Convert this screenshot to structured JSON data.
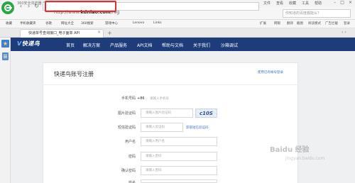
{
  "browser": {
    "title": "360安全浏览器 9.1",
    "menu": [
      "文件",
      "查看",
      "收藏",
      "工具",
      "帮助"
    ],
    "url_prefix": "http://www.",
    "url_domain": "kdniao.com",
    "url_path": "/reg",
    "search_placeholder": "你知道的百度都能么？",
    "bookmarks": [
      "收藏",
      "手机收藏夹",
      "谷歌",
      "网址大全",
      "360搜索",
      "游戏中心",
      "Lenovo",
      "Links"
    ],
    "bookmarks_right": [
      "扩展",
      "网银",
      "翻译",
      "截图",
      "阅读模式",
      "广告拦截",
      "登录"
    ],
    "tab_title": "快递单号查询接口_电子面单 API"
  },
  "site": {
    "logo": "快递鸟",
    "nav": [
      "首页",
      "解决方案",
      "产品服务",
      "API文档",
      "帮助与文档",
      "关于我们",
      "沙箱调试"
    ]
  },
  "form": {
    "title": "快递鸟账号注册",
    "login_link": "使用已有帐号登录",
    "phone_prefix": "+86",
    "captcha_text": "c10S",
    "sms_link": "获取短信验证码",
    "fields": [
      {
        "label": "手机号码",
        "placeholder": "请输入手机号"
      },
      {
        "label": "图片验证码",
        "placeholder": "请输入图片验证码"
      },
      {
        "label": "短信验证码",
        "placeholder": "请输入验证码"
      },
      {
        "label": "用户名",
        "placeholder": "请输入用户名"
      },
      {
        "label": "密码",
        "placeholder": "请输入密码"
      },
      {
        "label": "确认密码",
        "placeholder": "请输入密码"
      },
      {
        "label": "姓名",
        "placeholder": ""
      }
    ]
  },
  "watermark": {
    "text": "Baidu 经验",
    "sub": "jingyan.baidu.com"
  }
}
